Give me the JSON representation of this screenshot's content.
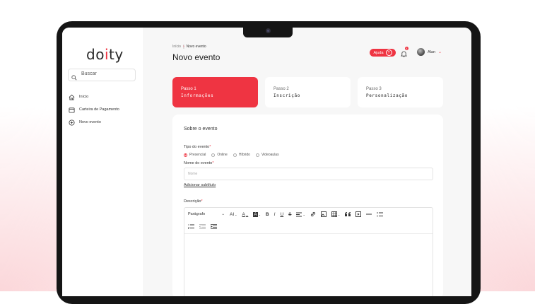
{
  "app": {
    "logo_prefix": "do",
    "logo_accent": "i",
    "logo_suffix": "ty"
  },
  "sidebar": {
    "search_label": "Buscar",
    "items": [
      {
        "label": "Início",
        "icon": "home-icon"
      },
      {
        "label": "Carteira de Pagamento",
        "icon": "wallet-icon"
      },
      {
        "label": "Novo evento",
        "icon": "plus-circle-icon"
      }
    ]
  },
  "header": {
    "breadcrumb_root": "Início",
    "breadcrumb_sep": "›",
    "breadcrumb_current": "Novo evento",
    "title": "Novo evento",
    "help_label": "Ajuda",
    "help_icon": "?",
    "notification_count": "4",
    "user_name": "Alan",
    "user_caret": "⌄"
  },
  "steps": [
    {
      "number": "Passo 1",
      "name": "Informações",
      "active": true
    },
    {
      "number": "Passo 2",
      "name": "Inscrição",
      "active": false
    },
    {
      "number": "Passo 3",
      "name": "Personalização",
      "active": false
    }
  ],
  "form": {
    "section_title": "Sobre o evento",
    "event_type_label": "Tipo do evento",
    "event_types": [
      "Presencial",
      "Online",
      "Híbrido",
      "Videoaulas"
    ],
    "selected_type": "Presencial",
    "name_label": "Nome do evento",
    "name_placeholder": "Nome",
    "add_subtitle_link": "Adicionar subtítulo",
    "description_label": "Descrição",
    "required_mark": "*"
  },
  "editor": {
    "paragraph_style": "Parágrafo",
    "dropdown_caret": "⌄",
    "tools": {
      "font_size": "AI",
      "font_color": "A",
      "highlight": "A",
      "bold": "B",
      "italic": "I",
      "underline": "U",
      "strike": "S"
    }
  },
  "colors": {
    "accent": "#ef3442"
  }
}
